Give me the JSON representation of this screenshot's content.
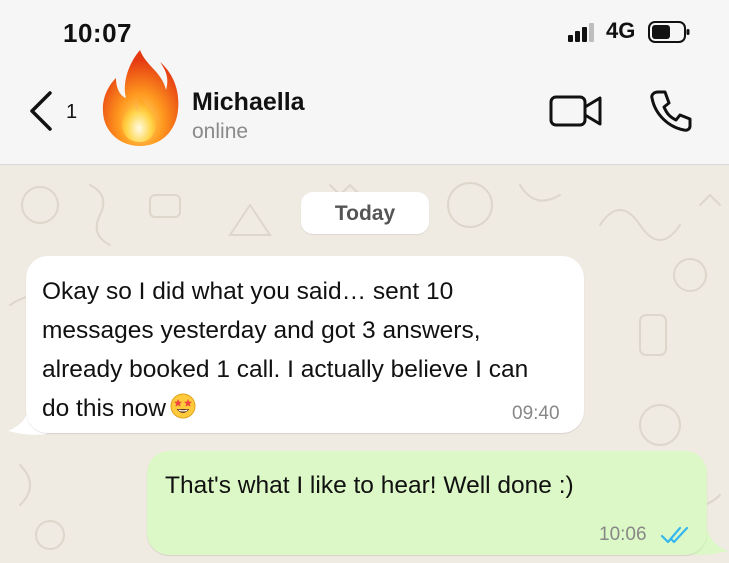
{
  "status_bar": {
    "time": "10:07",
    "network": "4G",
    "icons": [
      "signal-icon",
      "battery-icon"
    ]
  },
  "header": {
    "back_count": "1",
    "contact_name": "Michaella",
    "contact_status": "online",
    "avatar_icon": "fire-emoji",
    "actions": [
      "video-call-icon",
      "phone-call-icon"
    ]
  },
  "chat": {
    "date_label": "Today",
    "messages": [
      {
        "direction": "incoming",
        "text": "Okay so I did what you said… sent 10 messages yesterday and got 3 answers, already booked 1 call. I actually believe I can do this now",
        "emoji": "star-struck-emoji",
        "time": "09:40"
      },
      {
        "direction": "outgoing",
        "text": "That's what I like to hear! Well done :)",
        "time": "10:06",
        "read_receipt": "double-blue-tick"
      }
    ]
  },
  "colors": {
    "incoming_bubble": "#ffffff",
    "outgoing_bubble": "#dcf8c6",
    "chat_background": "#efeae2",
    "read_tick": "#34b7f1"
  }
}
